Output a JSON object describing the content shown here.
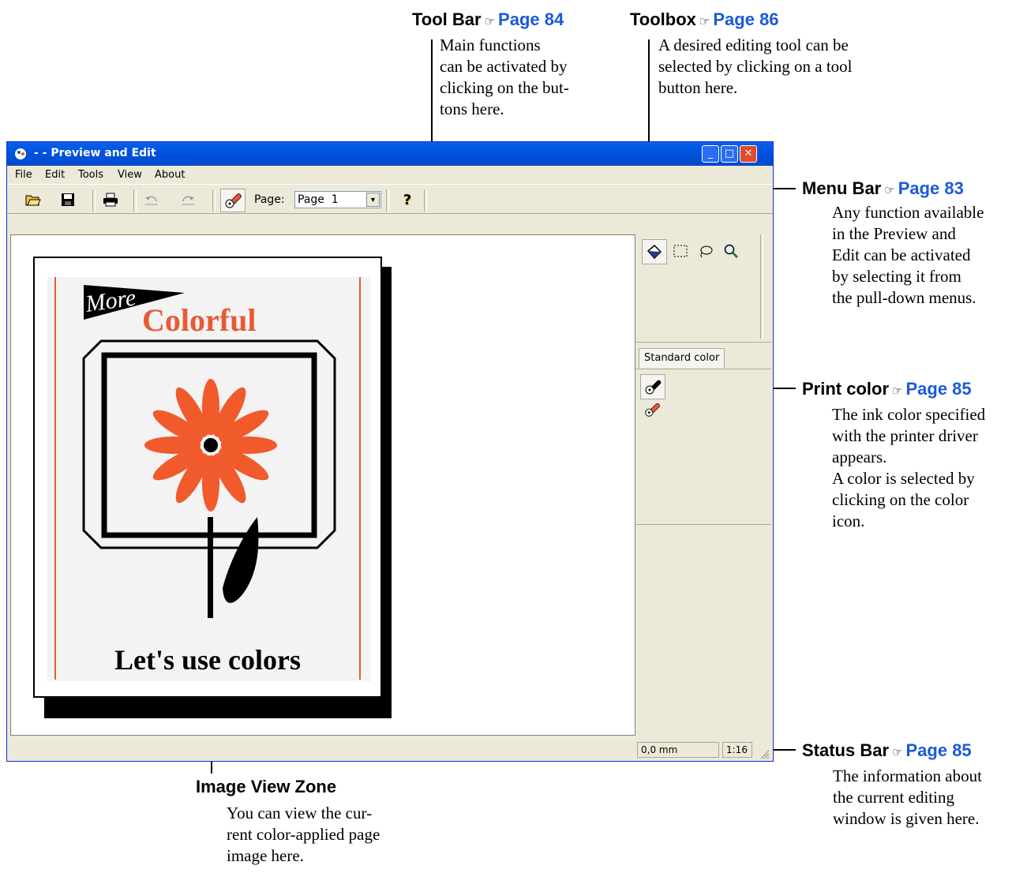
{
  "callouts": {
    "tool_bar": {
      "title": "Tool Bar",
      "page": "Page 84",
      "desc": [
        "Main functions",
        "can be activated by",
        "clicking on the but-",
        "tons here."
      ]
    },
    "toolbox": {
      "title": "Toolbox",
      "page": "Page 86",
      "desc": [
        "A desired editing tool can be",
        "selected by clicking on a tool",
        "button here."
      ]
    },
    "menu_bar": {
      "title": "Menu Bar",
      "page": "Page 83",
      "desc": [
        "Any function available",
        "in the Preview and",
        "Edit can be activated",
        "by selecting it from",
        "the pull-down menus."
      ]
    },
    "print_color": {
      "title": "Print color",
      "page": "Page 85",
      "desc": [
        "The ink color specified",
        "with the printer driver",
        "appears.",
        "A color is selected by",
        "clicking on the color",
        "icon."
      ]
    },
    "status_bar": {
      "title": "Status Bar",
      "page": "Page 85",
      "desc": [
        "The information about",
        "the current editing",
        "window is given here."
      ]
    },
    "image_view": {
      "title": "Image View Zone",
      "desc": [
        "You can view the cur-",
        "rent color-applied page",
        "image here."
      ]
    }
  },
  "ref_glyph": "☞",
  "window": {
    "title": "- - Preview and Edit",
    "menu": [
      "File",
      "Edit",
      "Tools",
      "View",
      "About"
    ],
    "toolbar": {
      "page_label": "Page:",
      "page_value": "Page  1",
      "help": "?"
    },
    "color_tab": "Standard color",
    "status": {
      "position": "0,0 mm",
      "scale": "1:16"
    }
  },
  "artwork": {
    "pennant": "More",
    "headline": "Colorful",
    "caption": "Let's use colors"
  },
  "colors": {
    "accent": "#e85a33",
    "link": "#1a5adb",
    "titlebar": "#0054e3",
    "chrome": "#ece9d8"
  },
  "icons": [
    "open-icon",
    "save-icon",
    "print-icon",
    "undo-icon",
    "redo-icon",
    "ink-icon",
    "help-icon",
    "fill-icon",
    "rect-select-icon",
    "lasso-icon",
    "zoom-icon",
    "black-ink-icon",
    "red-ink-icon"
  ]
}
